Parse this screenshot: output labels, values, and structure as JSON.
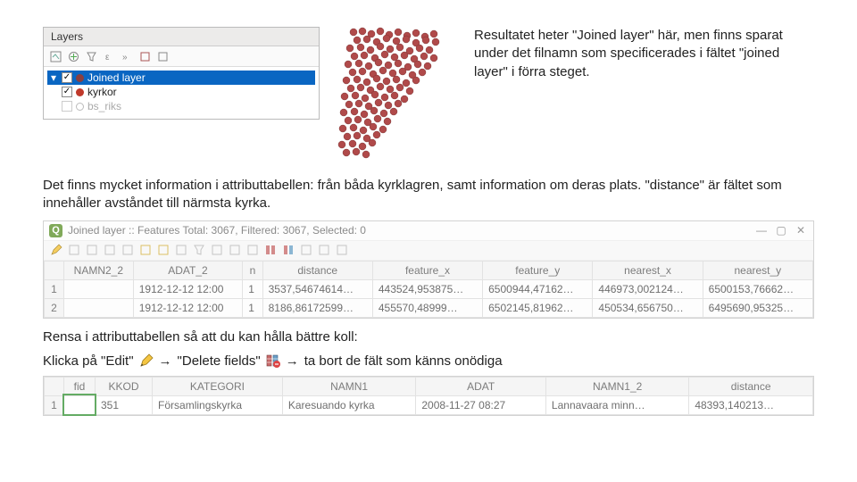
{
  "layers_panel": {
    "title": "Layers",
    "items": [
      {
        "checked": true,
        "expand": "▾",
        "color": "#8a3f3f",
        "label": "Joined layer",
        "selected": true
      },
      {
        "checked": true,
        "expand": "",
        "color": "#c0392b",
        "label": "kyrkor",
        "selected": false
      },
      {
        "checked": false,
        "expand": "",
        "color": "#b0b0b0",
        "label": "bs_riks",
        "selected": false
      }
    ]
  },
  "annotation": "Resultatet heter \"Joined layer\" här, men finns sparat under det filnamn som specificerades i fältet \"joined layer\" i förra steget.",
  "para1": "Det finns mycket information i attributtabellen: från båda kyrklagren, samt information om deras plats. \"distance\" är fältet som innehåller avståndet till närmsta kyrka.",
  "attr_window": {
    "title": "Joined layer :: Features Total: 3067, Filtered: 3067, Selected: 0",
    "columns": [
      "NAMN2_2",
      "ADAT_2",
      "n",
      "distance",
      "feature_x",
      "feature_y",
      "nearest_x",
      "nearest_y"
    ],
    "rows": [
      {
        "num": "1",
        "cells": [
          "",
          "1912-12-12 12:00",
          "1",
          "3537,54674614…",
          "443524,953875…",
          "6500944,47162…",
          "446973,002124…",
          "6500153,76662…"
        ]
      },
      {
        "num": "2",
        "cells": [
          "",
          "1912-12-12 12:00",
          "1",
          "8186,86172599…",
          "455570,48999…",
          "6502145,81962…",
          "450534,656750…",
          "6495690,95325…"
        ]
      }
    ]
  },
  "instr1": "Rensa i attributtabellen så att du kan hålla bättre koll:",
  "inline": {
    "t1": "Klicka på \"Edit\"",
    "arrow": "→",
    "t2": "\"Delete fields\"",
    "t3": "ta bort de fält som känns onödiga"
  },
  "attr_small": {
    "columns": [
      "fid",
      "KKOD",
      "KATEGORI",
      "NAMN1",
      "ADAT",
      "NAMN1_2",
      "distance"
    ],
    "rows": [
      {
        "num": "1",
        "cells": [
          "",
          "351",
          "Församlingskyrka",
          "Karesuando kyrka",
          "2008-11-27 08:27",
          "Lannavaara minn…",
          "48393,140213…"
        ]
      }
    ]
  }
}
